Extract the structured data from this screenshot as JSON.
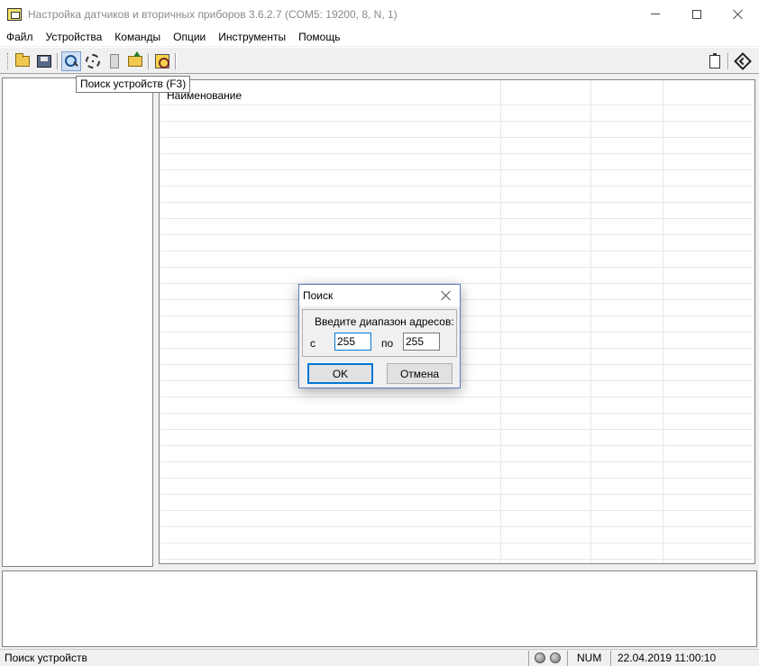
{
  "window": {
    "title": "Настройка датчиков и вторичных приборов 3.6.2.7 (COM5: 19200, 8, N, 1)",
    "icon": "app-icon"
  },
  "menu": {
    "items": [
      {
        "label": "Файл"
      },
      {
        "label": "Устройства"
      },
      {
        "label": "Команды"
      },
      {
        "label": "Опции"
      },
      {
        "label": "Инструменты"
      },
      {
        "label": "Помощь"
      }
    ]
  },
  "toolbar": {
    "buttons": [
      {
        "icon": "open-folder-icon"
      },
      {
        "icon": "save-icon"
      },
      {
        "icon": "device-search-icon",
        "pressed": true
      },
      {
        "icon": "scan-icon"
      },
      {
        "icon": "device-icon"
      },
      {
        "icon": "folder-up-icon"
      },
      {
        "icon": "tool-icon"
      },
      {
        "icon": "clipboard-icon"
      },
      {
        "icon": "exit-icon"
      }
    ],
    "tooltip": "Поиск устройств (F3)"
  },
  "grid": {
    "column_header": "Наименование"
  },
  "dialog": {
    "title": "Поиск",
    "prompt": "Введите диапазон адресов:",
    "from_label": "с",
    "from_value": "255",
    "to_label": "по",
    "to_value": "255",
    "ok_label": "OK",
    "cancel_label": "Отмена"
  },
  "status": {
    "message": "Поиск устройств",
    "num_indicator": "NUM",
    "datetime": "22.04.2019 11:00:10"
  }
}
